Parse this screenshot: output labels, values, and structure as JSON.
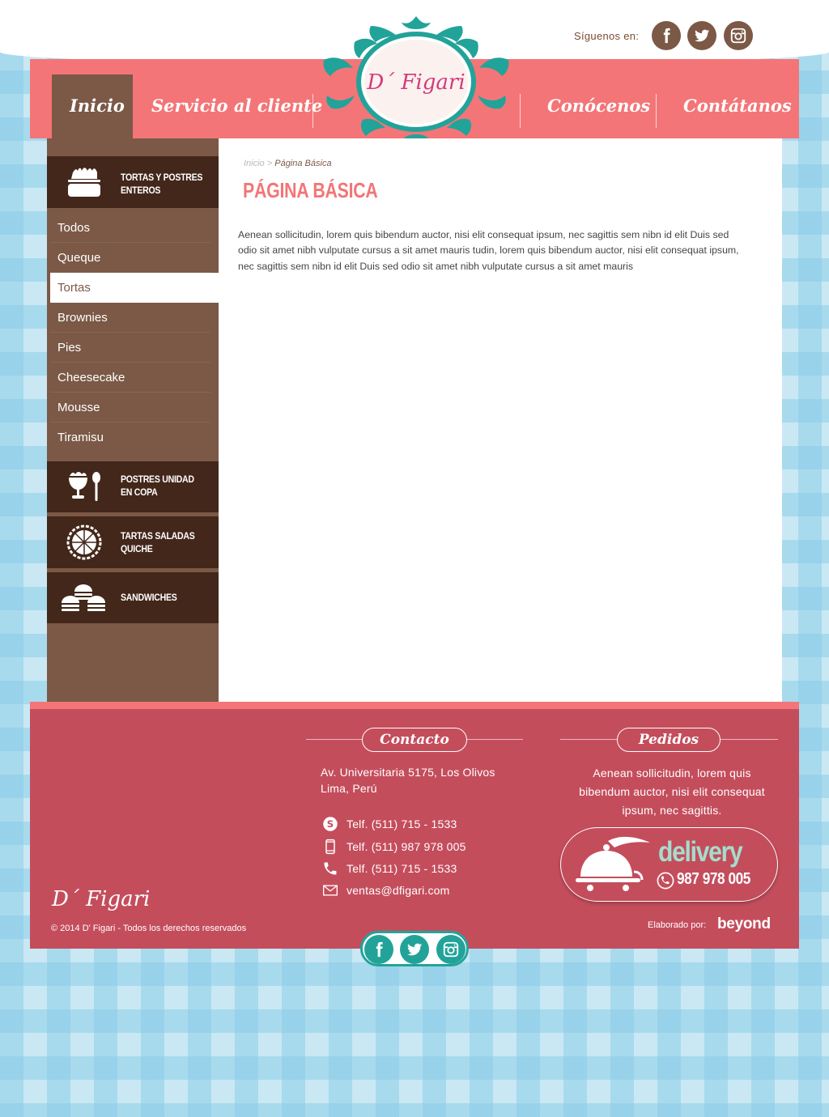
{
  "header": {
    "follow_label": "Síguenos en:",
    "social": [
      {
        "name": "facebook-icon"
      },
      {
        "name": "twitter-icon"
      },
      {
        "name": "instagram-icon"
      }
    ],
    "logo_text": "D´ Figari"
  },
  "nav": {
    "items": [
      {
        "label": "Inicio",
        "active": true
      },
      {
        "label": "Servicio al cliente"
      },
      {
        "label": "Conócenos"
      },
      {
        "label": "Contátanos"
      }
    ]
  },
  "sidebar": {
    "categories": [
      {
        "label": "Tortas y postres enteros",
        "icon": "cake-icon"
      },
      {
        "label": "Postres unidad en copa",
        "icon": "cup-dessert-icon"
      },
      {
        "label": "Tartas saladas quiche",
        "icon": "pie-icon"
      },
      {
        "label": "Sandwiches",
        "icon": "sandwich-icon"
      }
    ],
    "subitems": [
      "Todos",
      "Queque",
      "Tortas",
      "Brownies",
      "Pies",
      "Cheesecake",
      "Mousse",
      "Tiramisu"
    ],
    "active_subitem": "Tortas"
  },
  "main": {
    "breadcrumb": {
      "home": "Inicio",
      "separator": " > ",
      "current": "Página Básica"
    },
    "title": "PÁGINA BÁSICA",
    "body": "Aenean sollicitudin, lorem quis bibendum auctor, nisi elit consequat ipsum, nec sagittis sem nibn id elit Duis sed odio sit amet nibh vulputate cursus a sit amet mauris tudin, lorem quis bibendum auctor, nisi elit consequat ipsum, nec sagittis sem nibn id elit Duis sed odio sit amet nibh vulputate cursus a sit amet mauris"
  },
  "footer": {
    "contact_title": "Contacto",
    "address_line1": "Av. Universitaria 5175, Los Olivos",
    "address_line2": "Lima, Perú",
    "phones": [
      {
        "icon": "skype-icon",
        "text": "Telf. (511) 715 - 1533"
      },
      {
        "icon": "mobile-phone-icon",
        "text": "Telf. (511) 987 978 005"
      },
      {
        "icon": "phone-icon",
        "text": "Telf. (511) 715 - 1533"
      },
      {
        "icon": "email-icon",
        "text": "ventas@dfigari.com"
      }
    ],
    "pedidos_title": "Pedidos",
    "pedidos_text": "Aenean sollicitudin, lorem quis bibendum auctor, nisi elit consequat ipsum, nec sagittis.",
    "delivery_label": "delivery",
    "delivery_phone": "987 978 005",
    "logo_text": "D´ Figari",
    "copyright": "© 2014 D' Figari - Todos los derechos reservados",
    "made_by_label": "Elaborado por:",
    "made_by_brand": "beyond"
  },
  "colors": {
    "nav_pink": "#f47577",
    "brown": "#7b5946",
    "dark_brown": "#43271a",
    "footer_red": "#c44d5c",
    "teal": "#22a39a"
  }
}
